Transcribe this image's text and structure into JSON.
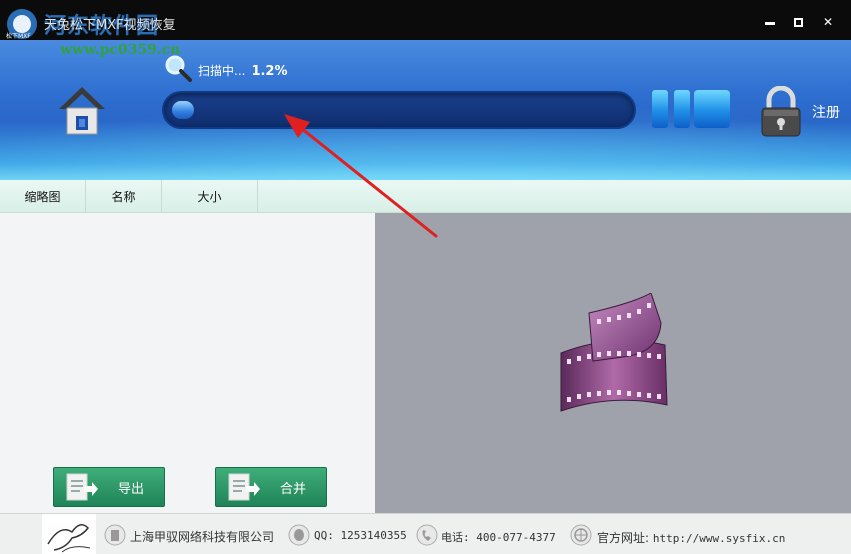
{
  "window": {
    "title": "天兔松下MXF视频恢复",
    "logo_caption": "松下MXF",
    "watermark": "河东软件园",
    "watermark_url": "www.pc0359.cn"
  },
  "header": {
    "scan_label": "扫描中...",
    "scan_percent_text": "1.2%",
    "progress_fraction": 0.012,
    "register_label": "注册"
  },
  "columns": {
    "thumbnail": "缩略图",
    "name": "名称",
    "size": "大小"
  },
  "actions": {
    "export_label": "导出",
    "merge_label": "合并"
  },
  "footer": {
    "company": "上海甲驭网络科技有限公司",
    "qq": "QQ: 1253140355",
    "phone": "电话: 400-077-4377",
    "website_label": "官方网址: ",
    "website_url": "http://www.sysfix.cn"
  },
  "colors": {
    "header_blue": "#2e6fd0",
    "button_green": "#1f8357",
    "preview_gray": "#9fa2ab",
    "annotation_red": "#e02020"
  }
}
